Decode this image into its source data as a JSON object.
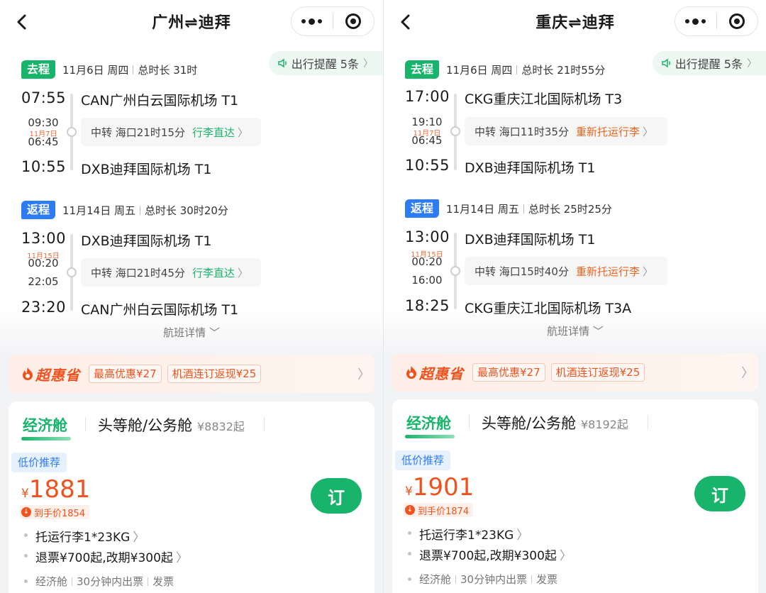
{
  "panels": [
    {
      "title": "广州⇌迪拜",
      "notice": "出行提醒 5条",
      "outbound": {
        "tag": "去程",
        "date": "11月6日 周四",
        "duration": "总时长 31时",
        "dep_time": "07:55",
        "dep_airport": "CAN广州白云国际机场 T1",
        "mid_arr": "09:30",
        "mid_note": "11月7日",
        "mid_dep": "06:45",
        "transfer": "中转 海口21时15分",
        "transfer_link": "行李直达",
        "arr_time": "10:55",
        "arr_airport": "DXB迪拜国际机场 T1"
      },
      "inbound": {
        "tag": "返程",
        "date": "11月14日 周五",
        "duration": "总时长 30时20分",
        "dep_time": "13:00",
        "dep_airport": "DXB迪拜国际机场 T1",
        "mid_note": "11月15日",
        "mid_arr": "00:20",
        "mid_dep": "22:05",
        "transfer": "中转 海口21时45分",
        "transfer_link": "行李直达",
        "arr_time": "23:20",
        "arr_airport": "CAN广州白云国际机场 T1"
      },
      "details": "航班详情",
      "promo": {
        "brand": "超惠省",
        "chip1": "最高优惠¥27",
        "chip2": "机酒连订返现¥25"
      },
      "cabin": {
        "tab_eco": "经济舱",
        "tab_first": "头等舱/公务舱",
        "first_price": "¥8832起",
        "low_tag": "低价推荐",
        "yen": "¥",
        "price": "1881",
        "net": "到手价1854",
        "book": "订",
        "baggage": "托运行李1*23KG",
        "refund": "退票¥700起,改期¥300起",
        "foot1": "经济舱",
        "foot2": "30分钟内出票",
        "foot3": "发票"
      }
    },
    {
      "title": "重庆⇌迪拜",
      "notice": "出行提醒 5条",
      "outbound": {
        "tag": "去程",
        "date": "11月6日 周四",
        "duration": "总时长 21时55分",
        "dep_time": "17:00",
        "dep_airport": "CKG重庆江北国际机场 T3",
        "mid_arr": "19:10",
        "mid_note": "11月7日",
        "mid_dep": "06:45",
        "transfer": "中转 海口11时35分",
        "transfer_link": "重新托运行李",
        "arr_time": "10:55",
        "arr_airport": "DXB迪拜国际机场 T1"
      },
      "inbound": {
        "tag": "返程",
        "date": "11月14日 周五",
        "duration": "总时长 25时25分",
        "dep_time": "13:00",
        "dep_airport": "DXB迪拜国际机场 T1",
        "mid_note": "11月15日",
        "mid_arr": "00:20",
        "mid_dep": "16:00",
        "transfer": "中转 海口15时40分",
        "transfer_link": "重新托运行李",
        "arr_time": "18:25",
        "arr_airport": "CKG重庆江北国际机场 T3A"
      },
      "details": "航班详情",
      "promo": {
        "brand": "超惠省",
        "chip1": "最高优惠¥27",
        "chip2": "机酒连订返现¥25"
      },
      "cabin": {
        "tab_eco": "经济舱",
        "tab_first": "头等舱/公务舱",
        "first_price": "¥8192起",
        "low_tag": "低价推荐",
        "yen": "¥",
        "price": "1901",
        "net": "到手价1874",
        "book": "订",
        "baggage": "托运行李1*23KG",
        "refund": "退票¥700起,改期¥300起",
        "foot1": "经济舱",
        "foot2": "30分钟内出票",
        "foot3": "发票"
      }
    }
  ],
  "colors": {
    "green": "#19b46b",
    "blue": "#2d7cf6",
    "orange": "#f0521e"
  },
  "icons": [
    "back-arrow-icon",
    "more-dots-icon",
    "target-icon",
    "speaker-icon",
    "chevron-right-icon",
    "chevron-down-icon",
    "flame-icon",
    "down-arrow-icon"
  ]
}
